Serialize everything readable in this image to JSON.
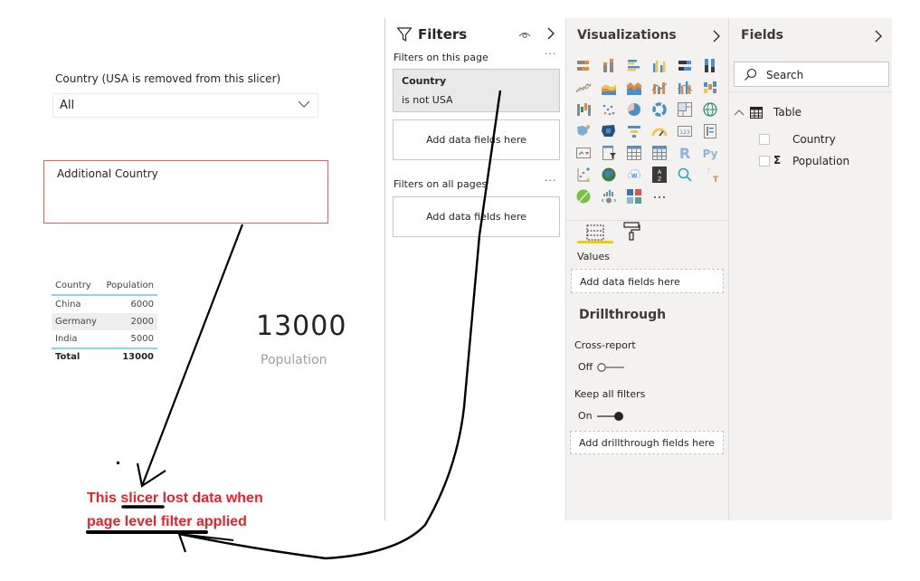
{
  "canvas": {
    "slicer": {
      "title": "Country (USA is removed from this slicer)",
      "selected": "All"
    },
    "additional_slicer": {
      "title": "Additional Country"
    },
    "table": {
      "headers": [
        "Country",
        "Population"
      ],
      "rows": [
        {
          "country": "China",
          "population": "6000"
        },
        {
          "country": "Germany",
          "population": "2000"
        },
        {
          "country": "India",
          "population": "5000"
        }
      ],
      "total_label": "Total",
      "total_value": "13000"
    },
    "card": {
      "value": "13000",
      "label": "Population"
    }
  },
  "filters_pane": {
    "title": "Filters",
    "page_section": "Filters on this page",
    "filter_card": {
      "field": "Country",
      "condition": "is not USA"
    },
    "add_fields_page": "Add data fields here",
    "all_pages_section": "Filters on all pages",
    "add_fields_all": "Add data fields here",
    "more": "···"
  },
  "visualizations_pane": {
    "title": "Visualizations",
    "icons": [
      "stacked-bar-chart-icon",
      "stacked-column-chart-icon",
      "clustered-bar-chart-icon",
      "clustered-column-chart-icon",
      "100-stacked-bar-chart-icon",
      "100-stacked-column-chart-icon",
      "line-chart-icon",
      "area-chart-icon",
      "stacked-area-chart-icon",
      "line-and-stacked-column-icon",
      "line-and-clustered-column-icon",
      "ribbon-chart-icon",
      "waterfall-chart-icon",
      "scatter-chart-icon",
      "pie-chart-icon",
      "donut-chart-icon",
      "treemap-icon",
      "map-icon",
      "filled-map-icon",
      "shape-map-icon",
      "funnel-icon",
      "gauge-icon",
      "card-icon",
      "multi-row-card-icon",
      "kpi-icon",
      "slicer-icon",
      "table-icon",
      "matrix-icon",
      "r-visual-icon",
      "python-visual-icon",
      "key-influencers-icon",
      "arcgis-map-icon",
      "word-cloud-icon",
      "sort-az-icon",
      "qa-icon",
      "smart-narrative-icon",
      "custom-leaf-visual-icon",
      "decomposition-tree-icon",
      "power-apps-icon",
      "more-visuals-icon"
    ],
    "values_label": "Values",
    "values_well": "Add data fields here",
    "drillthrough_title": "Drillthrough",
    "cross_report_label": "Cross-report",
    "cross_report_state": "Off",
    "keep_filters_label": "Keep all filters",
    "keep_filters_state": "On",
    "drill_well": "Add drillthrough fields here"
  },
  "fields_pane": {
    "title": "Fields",
    "search_placeholder": "Search",
    "table_name": "Table",
    "fields": [
      {
        "name": "Country",
        "type": "text"
      },
      {
        "name": "Population",
        "type": "sum"
      }
    ]
  },
  "annotation": {
    "line1_pre": "This ",
    "line1_word": "slicer",
    "line1_post": " lost data when",
    "line2": "page level filter applied",
    "color": "#e8212b"
  }
}
